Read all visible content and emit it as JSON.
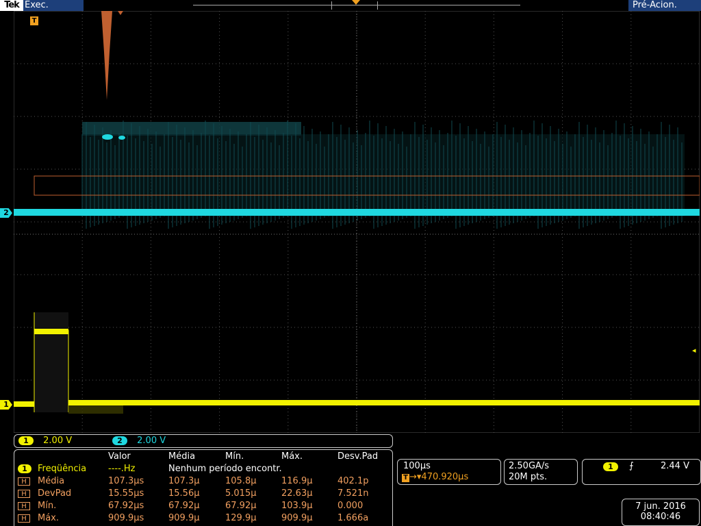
{
  "top": {
    "brand": "Tek",
    "run_state": "Exec.",
    "acq_state": "Pré-Acion."
  },
  "markers": {
    "ch1": "1",
    "ch2": "2",
    "trigger": "T"
  },
  "channels": {
    "ch1": {
      "num": "1",
      "scale": "2.00 V",
      "color": "#f2f200"
    },
    "ch2": {
      "num": "2",
      "scale": "2.00 V",
      "color": "#1fd8e0"
    }
  },
  "measurements": {
    "headers": [
      "Valor",
      "Média",
      "Mín.",
      "Máx.",
      "Desv.Pad"
    ],
    "freq": {
      "ch": "1",
      "label": "Freqüência",
      "value": "----.Hz",
      "note": "Nenhum período encontr."
    },
    "rows": [
      {
        "tag": "H",
        "label": "Média",
        "v": [
          "107.3μs",
          "107.3μ",
          "105.8μ",
          "116.9μ",
          "402.1p"
        ]
      },
      {
        "tag": "H",
        "label": "DevPad",
        "v": [
          "15.55μs",
          "15.56μ",
          "5.015μ",
          "22.63μ",
          "7.521n"
        ]
      },
      {
        "tag": "H",
        "label": "Mín.",
        "v": [
          "67.92μs",
          "67.92μ",
          "67.92μ",
          "103.9μ",
          "0.000"
        ]
      },
      {
        "tag": "H",
        "label": "Máx.",
        "v": [
          "909.9μs",
          "909.9μ",
          "129.9μ",
          "909.9μ",
          "1.666a"
        ]
      }
    ]
  },
  "horizontal": {
    "scale": "100μs",
    "delay_tag": "T",
    "delay": "→▾470.920μs"
  },
  "acquisition": {
    "sample_rate": "2.50GA/s",
    "record_length": "20M pts."
  },
  "trigger": {
    "source": "1",
    "slope": "⨍",
    "level": "2.44 V"
  },
  "datetime": {
    "date": "7 jun. 2016",
    "time": "08:40:46"
  }
}
